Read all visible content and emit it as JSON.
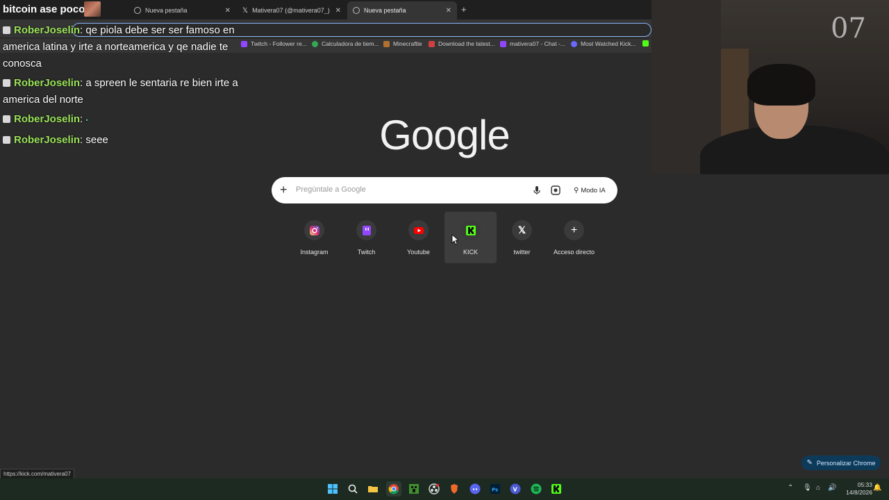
{
  "stream_overlay": {
    "title": "bitcoin ase poco",
    "chat": [
      {
        "user": "RoberJoselin",
        "message": "qe piola debe ser ser famoso en america latina y irte a norteamerica y qe nadie te conosca"
      },
      {
        "user": "RoberJoselin",
        "message": "a spreen le sentaria re bien irte a america del norte"
      },
      {
        "user": "RoberJoselin",
        "message": ""
      },
      {
        "user": "RoberJoselin",
        "message": "seee"
      }
    ],
    "webcam_mark": "07"
  },
  "browser": {
    "tabs": [
      {
        "title": "Nueva pestaña",
        "active": false
      },
      {
        "title": "Mativera07 (@mativera07_) / X",
        "active": false
      },
      {
        "title": "Nueva pestaña",
        "active": true
      }
    ],
    "bookmarks": [
      {
        "label": "Twitch - Follower re...",
        "color": "#9146ff"
      },
      {
        "label": "Calculadora de tiem...",
        "color": "#34a853"
      },
      {
        "label": "Minecraftle",
        "color": "#b07030"
      },
      {
        "label": "Download the latest...",
        "color": "#d04040"
      },
      {
        "label": "mativera07 - Chat -...",
        "color": "#9146ff"
      },
      {
        "label": "Most Watched Kick...",
        "color": "#6a6aff"
      }
    ],
    "status_url": "https://kick.com/mativera07"
  },
  "google": {
    "logo": "Google",
    "search_placeholder": "Pregúntale a Google",
    "ai_mode_label": "Modo IA",
    "shortcuts": [
      {
        "label": "Instagram",
        "icon": "instagram-icon"
      },
      {
        "label": "Twitch",
        "icon": "twitch-icon"
      },
      {
        "label": "Youtube",
        "icon": "youtube-icon"
      },
      {
        "label": "KICK",
        "icon": "kick-icon"
      },
      {
        "label": "twitter",
        "icon": "x-icon"
      },
      {
        "label": "Acceso directo",
        "icon": "plus-icon"
      }
    ],
    "customize_label": "Personalizar Chrome"
  },
  "taskbar": {
    "time": "05:33",
    "date": "14/8/2026"
  }
}
